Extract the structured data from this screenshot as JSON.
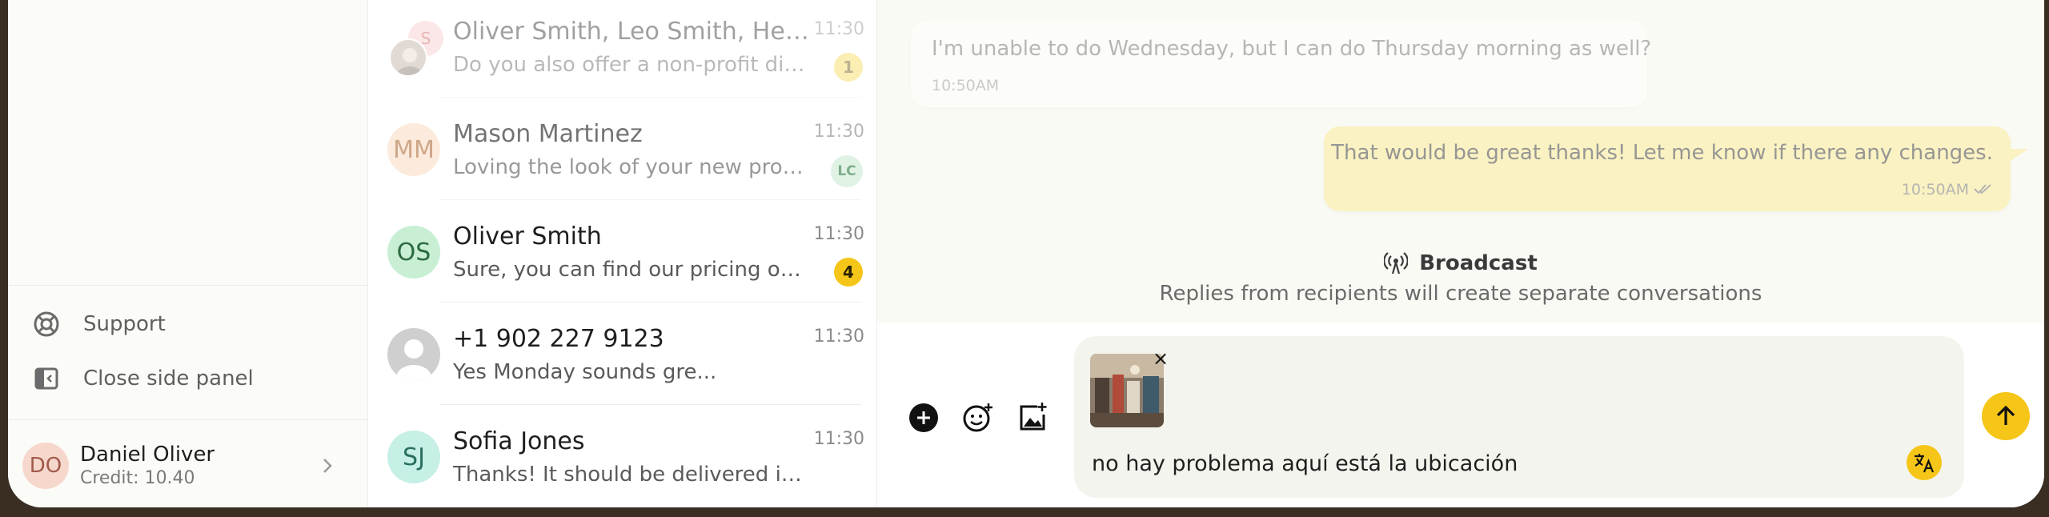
{
  "colors": {
    "accent": "#f5c518",
    "outgoing_bubble": "#fbeea3",
    "window_frame": "#3a2e22"
  },
  "sidebar": {
    "links": [
      {
        "label": "Support",
        "icon": "lifebuoy-icon"
      },
      {
        "label": "Close side panel",
        "icon": "side-panel-icon"
      }
    ],
    "user": {
      "initials": "DO",
      "name": "Daniel Oliver",
      "credit": "Credit: 10.40"
    }
  },
  "conversations": [
    {
      "name": "Oliver Smith, Leo Smith, Hect...",
      "preview": "Do you also offer a non-profit dis...",
      "time": "11:30",
      "badge": "1",
      "avatar": "group-photo",
      "group_initial": "S"
    },
    {
      "name": "Mason Martinez",
      "preview": "Loving the look of your new prod...",
      "time": "11:30",
      "badge": "LC",
      "initials": "MM"
    },
    {
      "name": "Oliver Smith",
      "preview": "Sure, you can find our pricing on...",
      "time": "11:30",
      "badge": "4",
      "initials": "OS"
    },
    {
      "name": "+1 902 227 9123",
      "preview": "Yes Monday sounds gre...",
      "time": "11:30",
      "avatar": "default-user-avatar"
    },
    {
      "name": "Sofia Jones",
      "preview": "Thanks! It should be delivered in...",
      "time": "11:30",
      "initials": "SJ"
    }
  ],
  "chat": {
    "messages": [
      {
        "direction": "incoming",
        "text": "I'm unable to do Wednesday, but I can do Thursday morning as well?",
        "time": "10:50AM"
      },
      {
        "direction": "outgoing",
        "text": "That would be great thanks! Let me know if there any changes.",
        "time": "10:50AM",
        "status": "read"
      }
    ],
    "broadcast": {
      "title": "Broadcast",
      "subtitle": "Replies from recipients will create separate conversations"
    },
    "composer": {
      "text": "no hay problema aquí está la ubicación",
      "attachment_close": "×",
      "tools": [
        "add-icon",
        "emoji-add-icon",
        "image-add-icon"
      ],
      "translate_icon": "translate-icon",
      "send_icon": "arrow-up-icon"
    }
  }
}
